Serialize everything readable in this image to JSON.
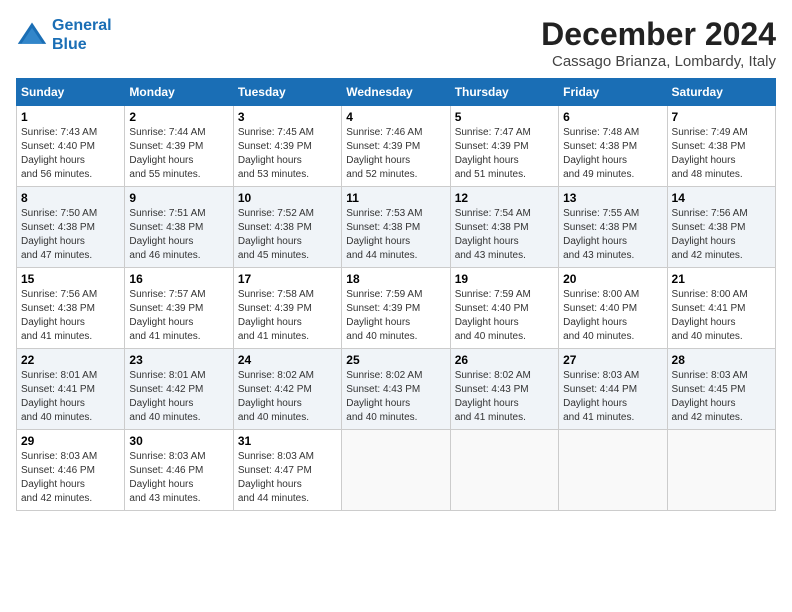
{
  "header": {
    "logo_line1": "General",
    "logo_line2": "Blue",
    "month": "December 2024",
    "location": "Cassago Brianza, Lombardy, Italy"
  },
  "weekdays": [
    "Sunday",
    "Monday",
    "Tuesday",
    "Wednesday",
    "Thursday",
    "Friday",
    "Saturday"
  ],
  "weeks": [
    [
      {
        "day": "1",
        "sunrise": "7:43 AM",
        "sunset": "4:40 PM",
        "daylight": "8 hours and 56 minutes."
      },
      {
        "day": "2",
        "sunrise": "7:44 AM",
        "sunset": "4:39 PM",
        "daylight": "8 hours and 55 minutes."
      },
      {
        "day": "3",
        "sunrise": "7:45 AM",
        "sunset": "4:39 PM",
        "daylight": "8 hours and 53 minutes."
      },
      {
        "day": "4",
        "sunrise": "7:46 AM",
        "sunset": "4:39 PM",
        "daylight": "8 hours and 52 minutes."
      },
      {
        "day": "5",
        "sunrise": "7:47 AM",
        "sunset": "4:39 PM",
        "daylight": "8 hours and 51 minutes."
      },
      {
        "day": "6",
        "sunrise": "7:48 AM",
        "sunset": "4:38 PM",
        "daylight": "8 hours and 49 minutes."
      },
      {
        "day": "7",
        "sunrise": "7:49 AM",
        "sunset": "4:38 PM",
        "daylight": "8 hours and 48 minutes."
      }
    ],
    [
      {
        "day": "8",
        "sunrise": "7:50 AM",
        "sunset": "4:38 PM",
        "daylight": "8 hours and 47 minutes."
      },
      {
        "day": "9",
        "sunrise": "7:51 AM",
        "sunset": "4:38 PM",
        "daylight": "8 hours and 46 minutes."
      },
      {
        "day": "10",
        "sunrise": "7:52 AM",
        "sunset": "4:38 PM",
        "daylight": "8 hours and 45 minutes."
      },
      {
        "day": "11",
        "sunrise": "7:53 AM",
        "sunset": "4:38 PM",
        "daylight": "8 hours and 44 minutes."
      },
      {
        "day": "12",
        "sunrise": "7:54 AM",
        "sunset": "4:38 PM",
        "daylight": "8 hours and 43 minutes."
      },
      {
        "day": "13",
        "sunrise": "7:55 AM",
        "sunset": "4:38 PM",
        "daylight": "8 hours and 43 minutes."
      },
      {
        "day": "14",
        "sunrise": "7:56 AM",
        "sunset": "4:38 PM",
        "daylight": "8 hours and 42 minutes."
      }
    ],
    [
      {
        "day": "15",
        "sunrise": "7:56 AM",
        "sunset": "4:38 PM",
        "daylight": "8 hours and 41 minutes."
      },
      {
        "day": "16",
        "sunrise": "7:57 AM",
        "sunset": "4:39 PM",
        "daylight": "8 hours and 41 minutes."
      },
      {
        "day": "17",
        "sunrise": "7:58 AM",
        "sunset": "4:39 PM",
        "daylight": "8 hours and 41 minutes."
      },
      {
        "day": "18",
        "sunrise": "7:59 AM",
        "sunset": "4:39 PM",
        "daylight": "8 hours and 40 minutes."
      },
      {
        "day": "19",
        "sunrise": "7:59 AM",
        "sunset": "4:40 PM",
        "daylight": "8 hours and 40 minutes."
      },
      {
        "day": "20",
        "sunrise": "8:00 AM",
        "sunset": "4:40 PM",
        "daylight": "8 hours and 40 minutes."
      },
      {
        "day": "21",
        "sunrise": "8:00 AM",
        "sunset": "4:41 PM",
        "daylight": "8 hours and 40 minutes."
      }
    ],
    [
      {
        "day": "22",
        "sunrise": "8:01 AM",
        "sunset": "4:41 PM",
        "daylight": "8 hours and 40 minutes."
      },
      {
        "day": "23",
        "sunrise": "8:01 AM",
        "sunset": "4:42 PM",
        "daylight": "8 hours and 40 minutes."
      },
      {
        "day": "24",
        "sunrise": "8:02 AM",
        "sunset": "4:42 PM",
        "daylight": "8 hours and 40 minutes."
      },
      {
        "day": "25",
        "sunrise": "8:02 AM",
        "sunset": "4:43 PM",
        "daylight": "8 hours and 40 minutes."
      },
      {
        "day": "26",
        "sunrise": "8:02 AM",
        "sunset": "4:43 PM",
        "daylight": "8 hours and 41 minutes."
      },
      {
        "day": "27",
        "sunrise": "8:03 AM",
        "sunset": "4:44 PM",
        "daylight": "8 hours and 41 minutes."
      },
      {
        "day": "28",
        "sunrise": "8:03 AM",
        "sunset": "4:45 PM",
        "daylight": "8 hours and 42 minutes."
      }
    ],
    [
      {
        "day": "29",
        "sunrise": "8:03 AM",
        "sunset": "4:46 PM",
        "daylight": "8 hours and 42 minutes."
      },
      {
        "day": "30",
        "sunrise": "8:03 AM",
        "sunset": "4:46 PM",
        "daylight": "8 hours and 43 minutes."
      },
      {
        "day": "31",
        "sunrise": "8:03 AM",
        "sunset": "4:47 PM",
        "daylight": "8 hours and 44 minutes."
      },
      null,
      null,
      null,
      null
    ]
  ]
}
